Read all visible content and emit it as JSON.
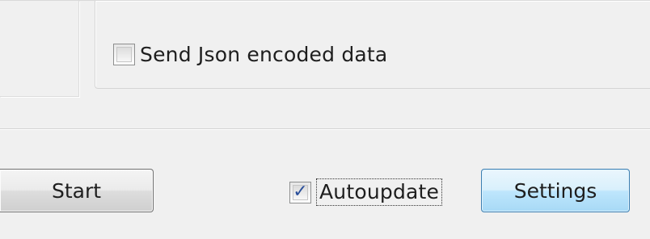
{
  "options": {
    "send_json_label": "Send Json encoded data",
    "send_json_checked": false
  },
  "footer": {
    "start_label": "Start",
    "autoupdate_label": "Autoupdate",
    "autoupdate_checked": true,
    "autoupdate_check_glyph": "✓",
    "settings_label": "Settings"
  },
  "icons": {
    "checkbox_checked": "check-mark-icon"
  },
  "colors": {
    "background": "#f0f0f0",
    "settings_button_accent": "#3c7fb1",
    "check_mark": "#2a4f9a"
  }
}
